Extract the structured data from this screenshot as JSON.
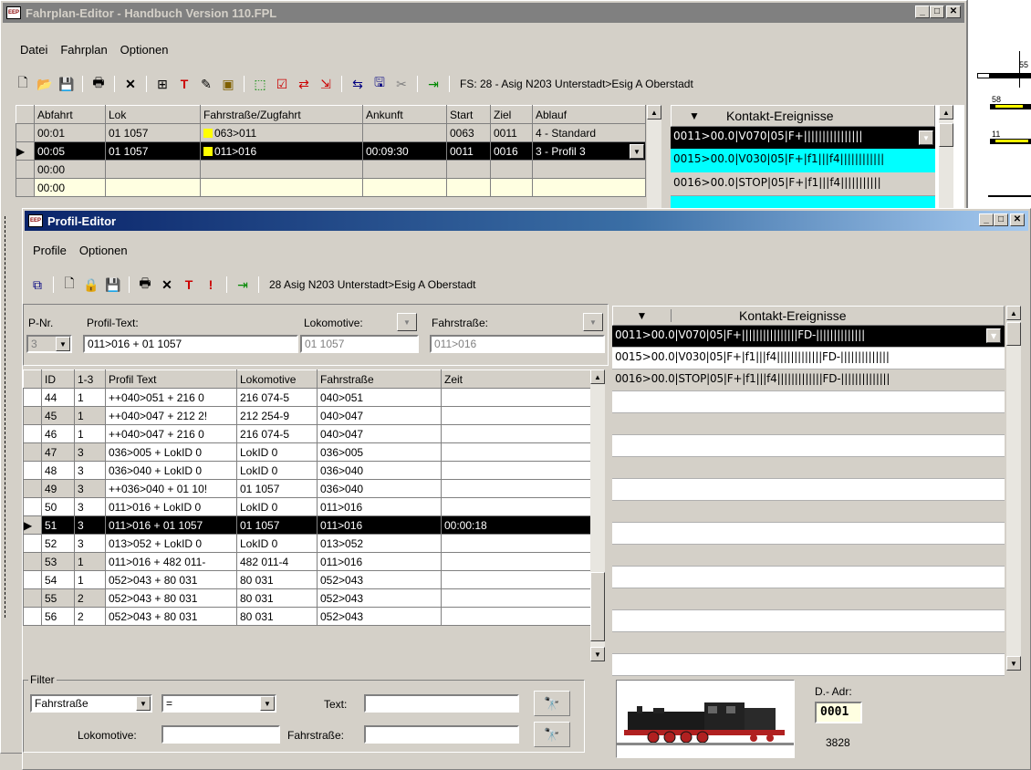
{
  "main_window": {
    "title": "Fahrplan-Editor - Handbuch Version 110.FPL",
    "menu": [
      "Datei",
      "Fahrplan",
      "Optionen"
    ],
    "status_text": "FS: 28 - Asig N203 Unterstadt>Esig A Oberstadt",
    "table_headers": [
      "Abfahrt",
      "Lok",
      "Fahrstraße/Zugfahrt",
      "Ankunft",
      "Start",
      "Ziel",
      "Ablauf"
    ],
    "rows": [
      {
        "abfahrt": "00:01",
        "lok": "01 1057",
        "fahrstrasse": "063>011",
        "ankunft": "",
        "start": "0063",
        "ziel": "0011",
        "ablauf": "4 - Standard"
      },
      {
        "abfahrt": "00:05",
        "lok": "01 1057",
        "fahrstrasse": "011>016",
        "ankunft": "00:09:30",
        "start": "0011",
        "ziel": "0016",
        "ablauf": "3 - Profil 3"
      },
      {
        "abfahrt": "00:00",
        "lok": "",
        "fahrstrasse": "",
        "ankunft": "",
        "start": "",
        "ziel": "",
        "ablauf": ""
      },
      {
        "abfahrt": "00:00",
        "lok": "",
        "fahrstrasse": "",
        "ankunft": "",
        "start": "",
        "ziel": "",
        "ablauf": ""
      }
    ],
    "events_header": "Kontakt-Ereignisse",
    "events": [
      "0011>00.0|V070|05|F+||||||||||||||||",
      "0015>00.0|V030|05|F+|f1|||f4||||||||||||",
      "0016>00.0|STOP|05|F+|f1|||f4|||||||||||"
    ]
  },
  "track_labels": [
    "55",
    "58",
    "11"
  ],
  "profil_editor": {
    "title": "Profil-Editor",
    "menu": [
      "Profile",
      "Optionen"
    ],
    "status_text": "28 Asig N203 Unterstadt>Esig A Oberstadt",
    "pnr_label": "P-Nr.",
    "pnr_value": "3",
    "profiltext_label": "Profil-Text:",
    "profiltext_value": "011>016 + 01 1057",
    "lokomotive_label": "Lokomotive:",
    "lokomotive_value": "01 1057",
    "fahrstrasse_label": "Fahrstraße:",
    "fahrstrasse_value": "011>016",
    "table_headers": [
      "ID",
      "1-3",
      "Profil Text",
      "Lokomotive",
      "Fahrstraße",
      "Zeit"
    ],
    "rows": [
      {
        "id": "44",
        "k": "1",
        "text": "++040>051 + 216 0",
        "lok": "216 074-5",
        "fs": "040>051",
        "zeit": ""
      },
      {
        "id": "45",
        "k": "1",
        "text": "++040>047 + 212 2!",
        "lok": "212 254-9",
        "fs": "040>047",
        "zeit": ""
      },
      {
        "id": "46",
        "k": "1",
        "text": "++040>047 + 216 0",
        "lok": "216 074-5",
        "fs": "040>047",
        "zeit": ""
      },
      {
        "id": "47",
        "k": "3",
        "text": "036>005 + LokID 0",
        "lok": "LokID 0",
        "fs": "036>005",
        "zeit": ""
      },
      {
        "id": "48",
        "k": "3",
        "text": "036>040 + LokID 0",
        "lok": "LokID 0",
        "fs": "036>040",
        "zeit": ""
      },
      {
        "id": "49",
        "k": "3",
        "text": "++036>040 + 01 10!",
        "lok": "01 1057",
        "fs": "036>040",
        "zeit": ""
      },
      {
        "id": "50",
        "k": "3",
        "text": "011>016 + LokID 0",
        "lok": "LokID 0",
        "fs": "011>016",
        "zeit": ""
      },
      {
        "id": "51",
        "k": "3",
        "text": "011>016 + 01 1057",
        "lok": "01 1057",
        "fs": "011>016",
        "zeit": "00:00:18"
      },
      {
        "id": "52",
        "k": "3",
        "text": "013>052 + LokID 0",
        "lok": "LokID 0",
        "fs": "013>052",
        "zeit": ""
      },
      {
        "id": "53",
        "k": "1",
        "text": "011>016 + 482 011-",
        "lok": "482 011-4",
        "fs": "011>016",
        "zeit": ""
      },
      {
        "id": "54",
        "k": "1",
        "text": "052>043 + 80 031",
        "lok": "80 031",
        "fs": "052>043",
        "zeit": ""
      },
      {
        "id": "55",
        "k": "2",
        "text": "052>043 + 80 031",
        "lok": "80 031",
        "fs": "052>043",
        "zeit": ""
      },
      {
        "id": "56",
        "k": "2",
        "text": "052>043 + 80 031",
        "lok": "80 031",
        "fs": "052>043",
        "zeit": ""
      }
    ],
    "events_header": "Kontakt-Ereignisse",
    "events": [
      "0011>00.0|V070|05|F+||||||||||||||||FD-||||||||||||||",
      "0015>00.0|V030|05|F+|f1|||f4|||||||||||||FD-||||||||||||||",
      "0016>00.0|STOP|05|F+|f1|||f4|||||||||||||FD-||||||||||||||"
    ],
    "filter": {
      "group_label": "Filter",
      "field_select": "Fahrstraße",
      "op_select": "=",
      "text_label": "Text:",
      "text_value": "",
      "lok_label": "Lokomotive:",
      "lok_value": "",
      "fs_label": "Fahrstraße:",
      "fs_value": ""
    },
    "dadr_label": "D.- Adr:",
    "dadr_value": "0001",
    "dadr_number": "3828"
  }
}
